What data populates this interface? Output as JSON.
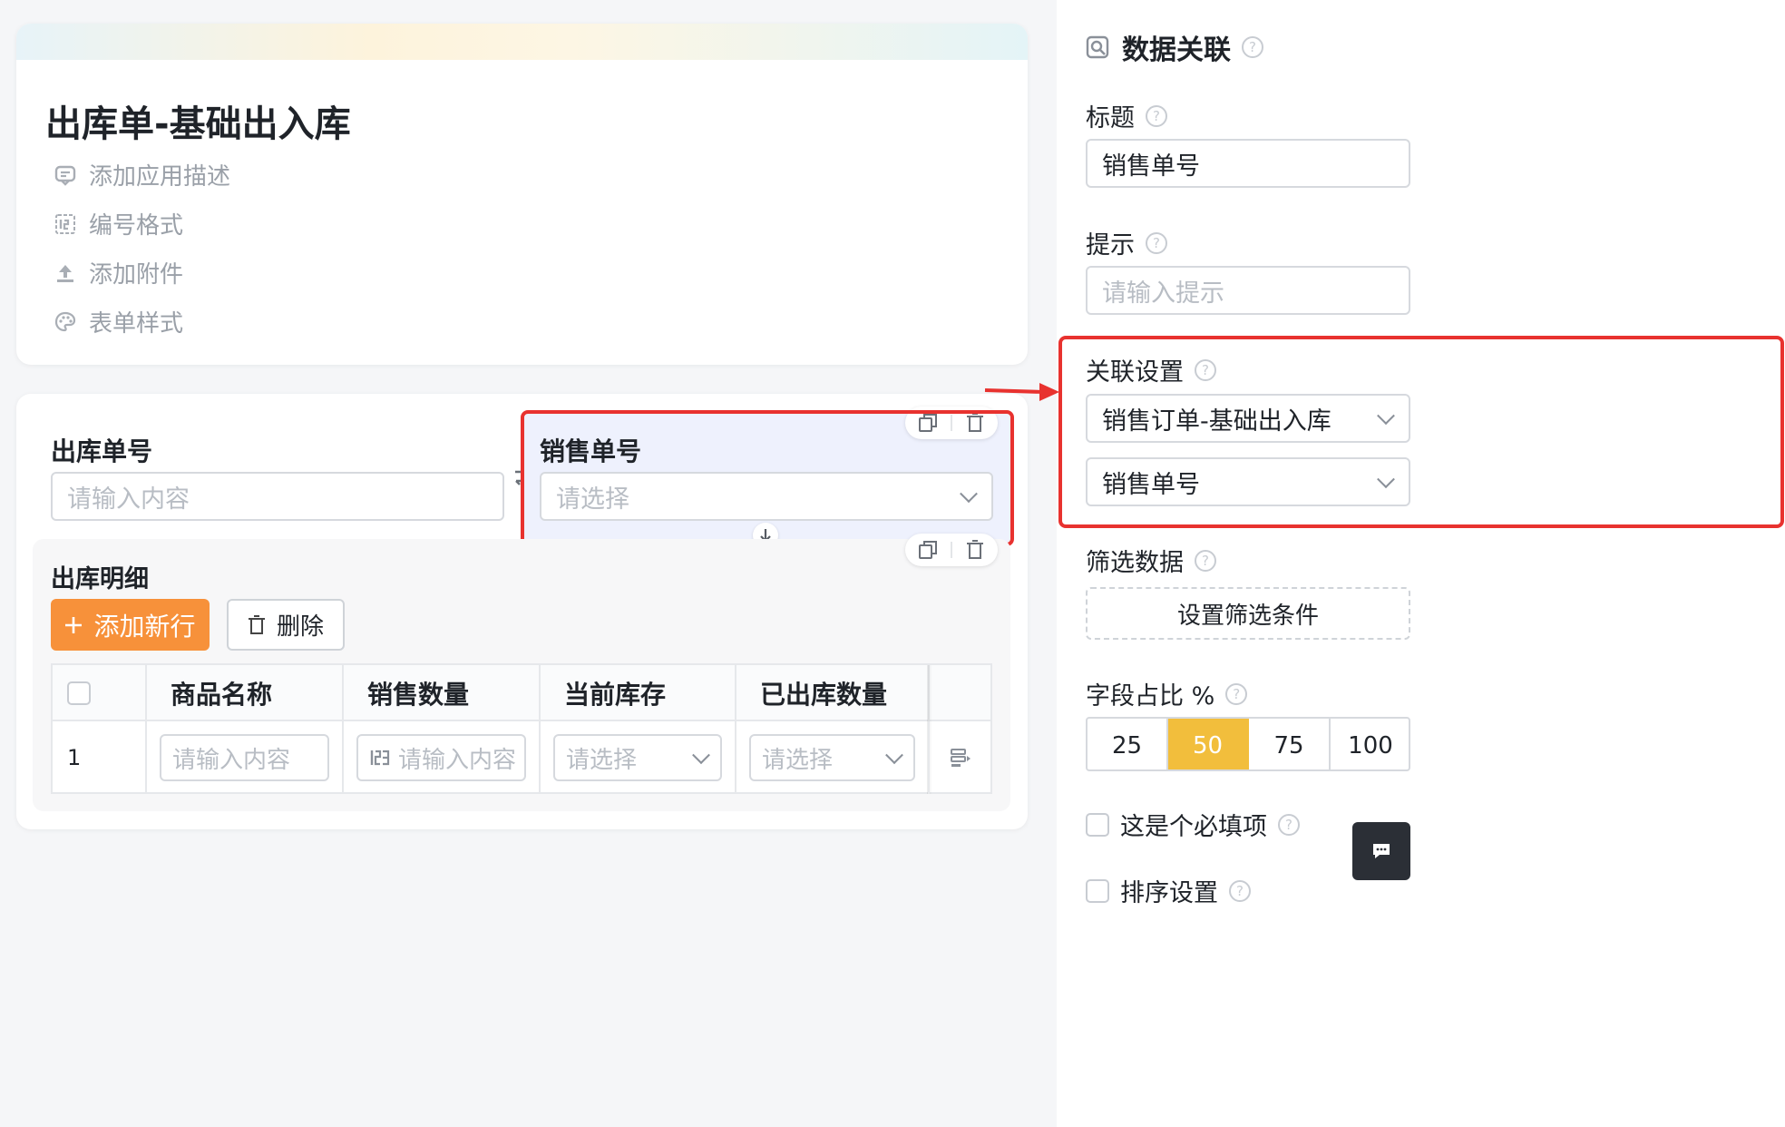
{
  "form": {
    "title": "出库单-基础出入库",
    "options": [
      {
        "icon": "comment-icon",
        "label": "添加应用描述"
      },
      {
        "icon": "number-format-icon",
        "label": "编号格式"
      },
      {
        "icon": "upload-icon",
        "label": "添加附件"
      },
      {
        "icon": "palette-icon",
        "label": "表单样式"
      }
    ]
  },
  "fields": {
    "outbound_no": {
      "label": "出库单号",
      "placeholder": "请输入内容"
    },
    "sales_no": {
      "label": "销售单号",
      "placeholder": "请选择"
    }
  },
  "detail": {
    "title": "出库明细",
    "add_button": "添加新行",
    "delete_button": "删除",
    "columns": [
      "商品名称",
      "销售数量",
      "当前库存",
      "已出库数量"
    ],
    "row": {
      "index": "1",
      "name_placeholder": "请输入内容",
      "qty_placeholder": "请输入内容",
      "stock_placeholder": "请选择",
      "out_placeholder": "请选择"
    }
  },
  "panel": {
    "title": "数据关联",
    "title_label": "标题",
    "title_value": "销售单号",
    "hint_label": "提示",
    "hint_placeholder": "请输入提示",
    "link_label": "关联设置",
    "link_form": "销售订单-基础出入库",
    "link_field": "销售单号",
    "filter_label": "筛选数据",
    "filter_button": "设置筛选条件",
    "width_label": "字段占比 %",
    "width_options": [
      "25",
      "50",
      "75",
      "100"
    ],
    "width_selected": "50",
    "required_label": "这是个必填项",
    "sort_label": "排序设置"
  },
  "colors": {
    "accent": "#f7913a",
    "selected": "#f2be3c",
    "highlight": "#e8322f",
    "selected_bg": "#eef1fd"
  }
}
